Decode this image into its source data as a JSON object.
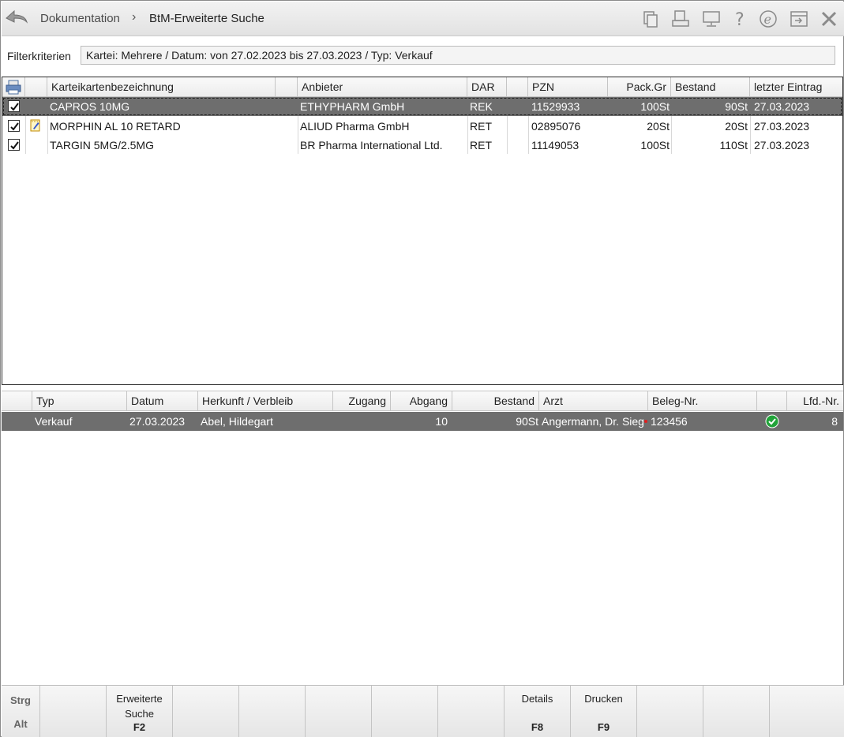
{
  "header": {
    "breadcrumb_root": "Dokumentation",
    "breadcrumb_separator": "›",
    "breadcrumb_current": "BtM-Erweiterte Suche",
    "icons": [
      "copy-icon",
      "print-preview-icon",
      "monitor-icon",
      "help-icon",
      "e-icon",
      "exit-window-icon",
      "close-icon"
    ]
  },
  "filter": {
    "label": "Filterkriterien",
    "value": "Kartei: Mehrere / Datum: von 27.02.2023 bis 27.03.2023 / Typ: Verkauf"
  },
  "upper_table": {
    "columns": {
      "name": "Karteikartenbezeichnung",
      "supplier": "Anbieter",
      "dar": "DAR",
      "pzn": "PZN",
      "pack": "Pack.Gr",
      "stock": "Bestand",
      "last": "letzter Eintrag"
    },
    "rows": [
      {
        "checked": true,
        "note": false,
        "name": "CAPROS 10MG",
        "supplier": "ETHYPHARM GmbH",
        "dar": "REK",
        "pzn": "11529933",
        "pack": "100St",
        "stock": "90St",
        "last": "27.03.2023"
      },
      {
        "checked": true,
        "note": true,
        "name": "MORPHIN AL 10 RETARD",
        "supplier": "ALIUD Pharma GmbH",
        "dar": "RET",
        "pzn": "02895076",
        "pack": "20St",
        "stock": "20St",
        "last": "27.03.2023"
      },
      {
        "checked": true,
        "note": false,
        "name": "TARGIN 5MG/2.5MG",
        "supplier": "BR Pharma International Ltd.",
        "dar": "RET",
        "pzn": "11149053",
        "pack": "100St",
        "stock": "110St",
        "last": "27.03.2023"
      }
    ]
  },
  "lower_table": {
    "columns": {
      "typ": "Typ",
      "datum": "Datum",
      "herkunft": "Herkunft / Verbleib",
      "zugang": "Zugang",
      "abgang": "Abgang",
      "bestand": "Bestand",
      "arzt": "Arzt",
      "beleg": "Beleg-Nr.",
      "lfd": "Lfd.-Nr."
    },
    "rows": [
      {
        "typ": "Verkauf",
        "datum": "27.03.2023",
        "herkunft": "Abel, Hildegart",
        "zugang": "",
        "abgang": "10",
        "bestand": "90St",
        "arzt": "Angermann, Dr. Sieg",
        "beleg": "123456",
        "status": "ok",
        "lfd": "8"
      }
    ]
  },
  "function_bar": {
    "mod1": "Strg",
    "mod2": "Alt",
    "keys": [
      {
        "label": "",
        "key": ""
      },
      {
        "label": "Erweiterte Suche",
        "key": "F2"
      },
      {
        "label": "",
        "key": ""
      },
      {
        "label": "",
        "key": ""
      },
      {
        "label": "",
        "key": ""
      },
      {
        "label": "",
        "key": ""
      },
      {
        "label": "",
        "key": ""
      },
      {
        "label": "Details",
        "key": "F8"
      },
      {
        "label": "Drucken",
        "key": "F9"
      },
      {
        "label": "",
        "key": ""
      },
      {
        "label": "",
        "key": ""
      },
      {
        "label": "",
        "key": ""
      }
    ]
  },
  "colors": {
    "selected_row": "#6e6e6e",
    "status_ok": "#22a33a",
    "note_icon": "#d9a400"
  }
}
